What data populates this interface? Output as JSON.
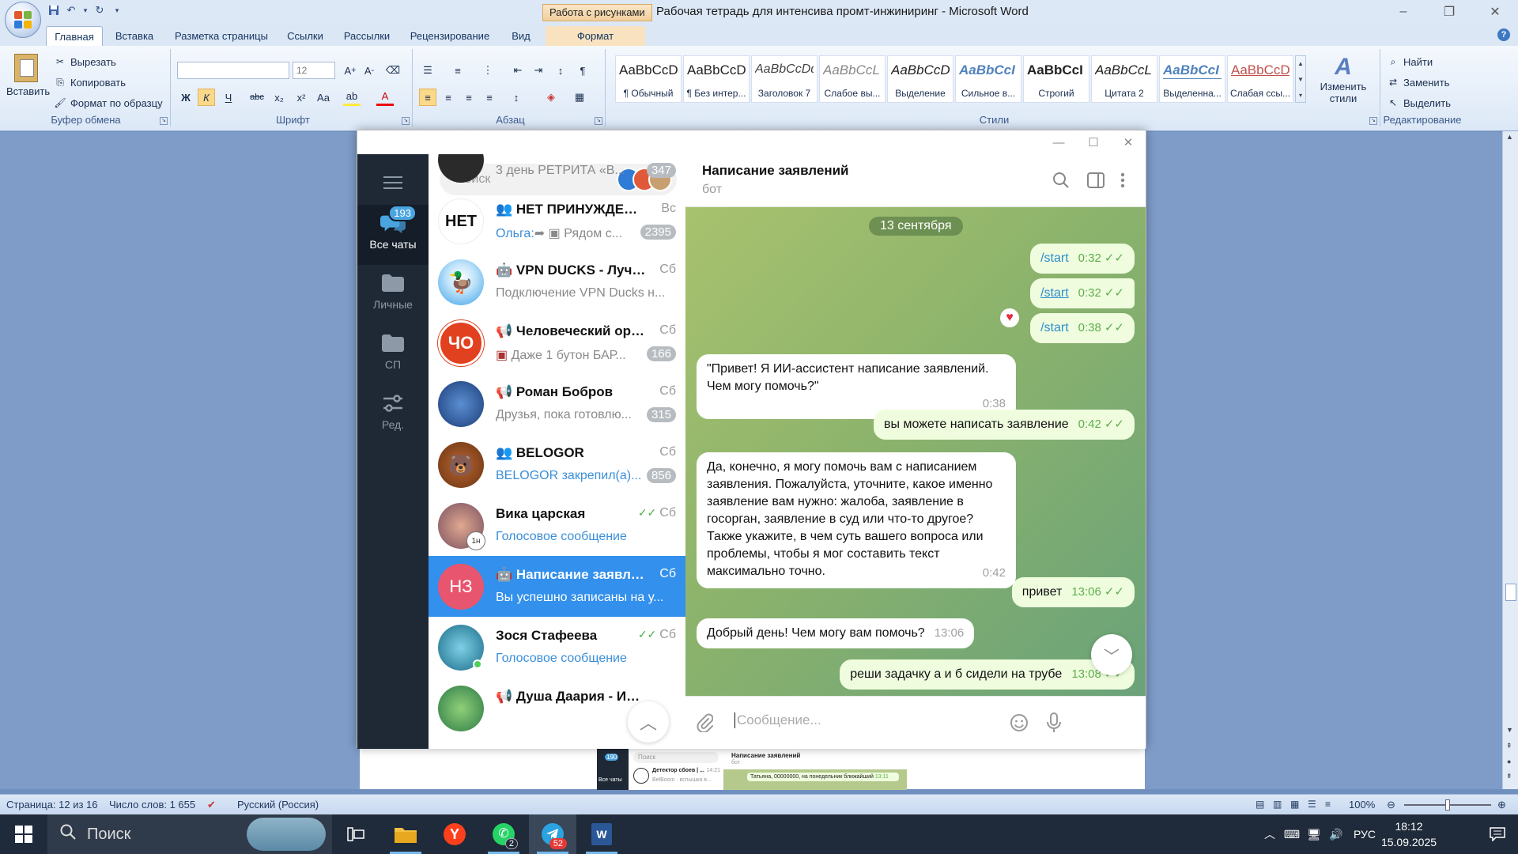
{
  "word": {
    "context_tab": "Работа с рисунками",
    "title": "Рабочая тетрадь для интенсива промт-инжиниринг - Microsoft Word",
    "tabs": [
      "Главная",
      "Вставка",
      "Разметка страницы",
      "Ссылки",
      "Рассылки",
      "Рецензирование",
      "Вид",
      "Формат"
    ],
    "active_tab": "Главная",
    "clipboard": {
      "paste": "Вставить",
      "cut": "Вырезать",
      "copy": "Копировать",
      "format_painter": "Формат по образцу",
      "label": "Буфер обмена"
    },
    "font": {
      "size": "12",
      "label": "Шрифт"
    },
    "paragraph": {
      "label": "Абзац"
    },
    "styles": {
      "items": [
        {
          "preview": "AaBbCcD",
          "name": "¶ Обычный"
        },
        {
          "preview": "AaBbCcD",
          "name": "¶ Без интер..."
        },
        {
          "preview": "AaBbCcDd",
          "name": "Заголовок 7"
        },
        {
          "preview": "AaBbCcL",
          "name": "Слабое вы..."
        },
        {
          "preview": "AaBbCcD",
          "name": "Выделение"
        },
        {
          "preview": "AaBbCcI",
          "name": "Сильное в..."
        },
        {
          "preview": "AaBbCcI",
          "name": "Строгий"
        },
        {
          "preview": "AaBbCcL",
          "name": "Цитата 2"
        },
        {
          "preview": "AaBbCcI",
          "name": "Выделенна..."
        },
        {
          "preview": "AaBbCcD",
          "name": "Слабая ссы..."
        }
      ],
      "change_styles": "Изменить стили",
      "label": "Стили"
    },
    "editing": {
      "find": "Найти",
      "replace": "Заменить",
      "select": "Выделить",
      "label": "Редактирование"
    },
    "status": {
      "page": "Страница: 12 из 16",
      "words": "Число слов: 1 655",
      "language": "Русский (Россия)",
      "zoom": "100%"
    },
    "thumbnail": {
      "search": "Поиск",
      "chat_title": "Написание заявлений",
      "chat_sub": "бот",
      "folder_badge": "190",
      "folder_label": "Все чаты",
      "chat_name": "Детектор сбоев | ...",
      "chat_time": "14:21",
      "chat_prev": "BelBoom · вспышка в...",
      "msg_text": "Татьяна, 00000000, на понедельник ближайший",
      "msg_time": "13:11"
    }
  },
  "telegram": {
    "folders": [
      {
        "label": "Все чаты",
        "badge": "193",
        "icon": "chat-bubbles-icon"
      },
      {
        "label": "Личные",
        "icon": "folder-icon"
      },
      {
        "label": "СП",
        "icon": "folder-icon"
      },
      {
        "label": "Ред.",
        "icon": "sliders-icon"
      }
    ],
    "search_placeholder": "Поиск",
    "chats": [
      {
        "name": "",
        "date": "",
        "preview": "3 день РЕТРИТА «В...",
        "badge": "347"
      },
      {
        "name": "НЕТ ПРИНУЖДЕНИ...",
        "date": "Вс",
        "preview": "Рядом с...",
        "sender": "Ольга:",
        "badge": "2395",
        "avatar_text": "НЕТ"
      },
      {
        "name": "VPN DUCKS - Лучши...",
        "date": "Сб",
        "preview": "Подключение VPN Ducks н..."
      },
      {
        "name": "Человеческий орган...",
        "date": "Сб",
        "preview": "Даже 1 бутон БАР...",
        "badge": "166",
        "avatar_text": "ЧО"
      },
      {
        "name": "Роман Бобров",
        "date": "Сб",
        "preview": "Друзья, пока готовлю...",
        "badge": "315"
      },
      {
        "name": "BELOGOR",
        "date": "Сб",
        "preview": "BELOGOR закрепил(а)...",
        "badge": "856"
      },
      {
        "name": "Вика царская",
        "date": "Сб",
        "preview": "Голосовое сообщение",
        "avatar_badge": "1н"
      },
      {
        "name": "Написание заявлен...",
        "date": "Сб",
        "preview": "Вы успешно записаны на у...",
        "avatar_text": "НЗ"
      },
      {
        "name": "Зося Стафеева",
        "date": "Сб",
        "preview": "Голосовое сообщение"
      },
      {
        "name": "Душа Даария - Исц...",
        "date": "",
        "preview": ""
      }
    ],
    "chat": {
      "title": "Написание заявлений",
      "subtitle": "бот",
      "date": "13 сентября",
      "messages": [
        {
          "dir": "out",
          "text": "/start",
          "time": "0:32"
        },
        {
          "dir": "out",
          "text": "/start",
          "time": "0:32"
        },
        {
          "dir": "out",
          "text": "/start",
          "time": "0:38"
        },
        {
          "dir": "in",
          "text": "\"Привет! Я ИИ-ассистент написание заявлений. Чем могу помочь?\"",
          "time": "0:38"
        },
        {
          "dir": "out",
          "text": "вы можете написать заявление",
          "time": "0:42"
        },
        {
          "dir": "in",
          "text": "Да, конечно, я могу помочь вам с написанием заявления. Пожалуйста, уточните, какое именно заявление вам нужно: жалоба, заявление в госорган, заявление в суд или что-то другое? Также укажите, в чем суть вашего вопроса или проблемы, чтобы я мог составить текст максимально точно.",
          "time": "0:42"
        },
        {
          "dir": "out",
          "text": "привет",
          "time": "13:06"
        },
        {
          "dir": "in",
          "text": "Добрый день! Чем могу вам помочь?",
          "time": "13:06"
        },
        {
          "dir": "out",
          "text": "реши задачку а и б сидели на трубе",
          "time": "13:08"
        }
      ],
      "input_placeholder": "Сообщение..."
    }
  },
  "taskbar": {
    "search": "Поиск",
    "whatsapp_badge": "2",
    "telegram_badge": "52",
    "lang": "РУС",
    "time": "18:12",
    "date": "15.09.2025"
  },
  "colors": {
    "telegram_accent": "#3390ec",
    "outgoing_bubble": "#effdde",
    "folder_bar": "#1f2936"
  }
}
